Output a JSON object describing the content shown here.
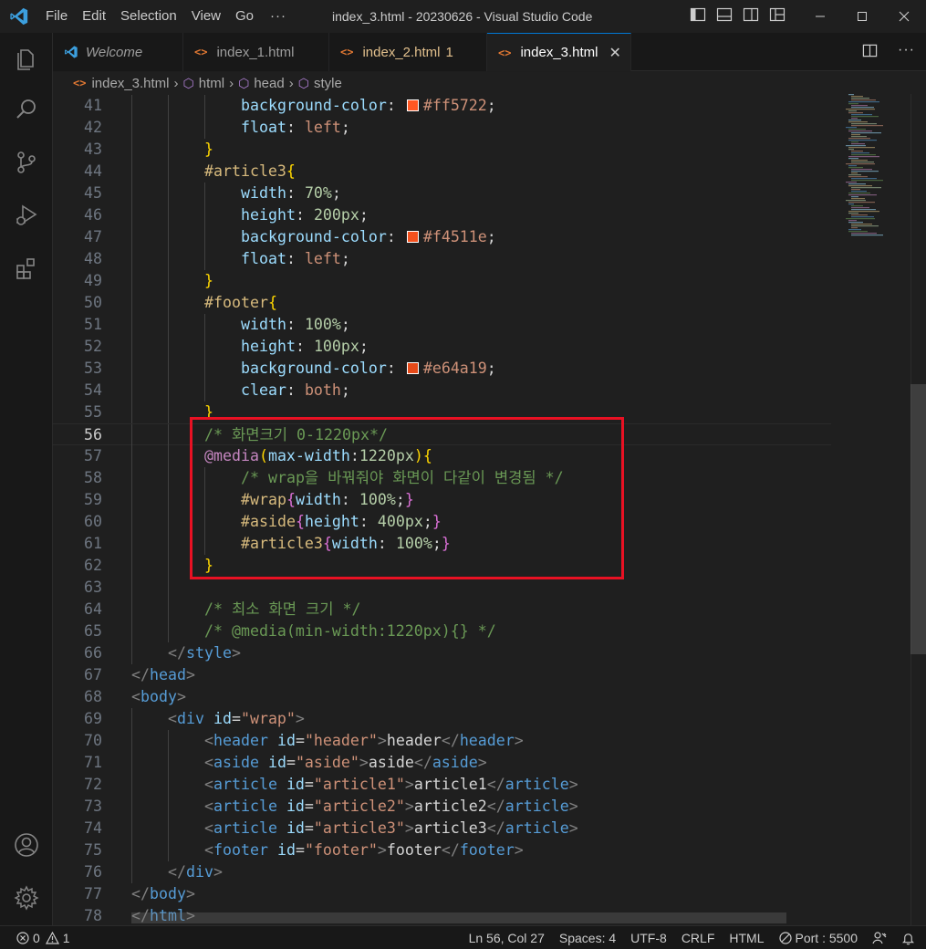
{
  "window": {
    "title": "index_3.html - 20230626 - Visual Studio Code",
    "menu": [
      "File",
      "Edit",
      "Selection",
      "View",
      "Go"
    ],
    "menu_more": "···"
  },
  "tabs": [
    {
      "label": "Welcome",
      "icon": "vscode-logo-icon",
      "state": "preview"
    },
    {
      "label": "index_1.html",
      "icon": "<>",
      "state": "normal"
    },
    {
      "label": "index_2.html",
      "icon": "<>",
      "state": "modified",
      "badge": "1"
    },
    {
      "label": "index_3.html",
      "icon": "<>",
      "state": "active"
    }
  ],
  "breadcrumb": [
    "index_3.html",
    "html",
    "head",
    "style"
  ],
  "editor": {
    "current_line": 56,
    "lines": [
      {
        "n": "41",
        "indent": 3,
        "tokens": [
          [
            "t-prop",
            "background-color"
          ],
          [
            "t-txt",
            ": "
          ],
          [
            "swatch",
            "#ff5722"
          ],
          [
            "t-str",
            "#ff5722"
          ],
          [
            "t-txt",
            ";"
          ]
        ]
      },
      {
        "n": "42",
        "indent": 3,
        "tokens": [
          [
            "t-prop",
            "float"
          ],
          [
            "t-txt",
            ": "
          ],
          [
            "t-str",
            "left"
          ],
          [
            "t-txt",
            ";"
          ]
        ]
      },
      {
        "n": "43",
        "indent": 2,
        "tokens": [
          [
            "t-b1",
            "}"
          ]
        ]
      },
      {
        "n": "44",
        "indent": 2,
        "tokens": [
          [
            "t-sel",
            "#article3"
          ],
          [
            "t-b1",
            "{"
          ]
        ]
      },
      {
        "n": "45",
        "indent": 3,
        "tokens": [
          [
            "t-prop",
            "width"
          ],
          [
            "t-txt",
            ": "
          ],
          [
            "t-num",
            "70%"
          ],
          [
            "t-txt",
            ";"
          ]
        ]
      },
      {
        "n": "46",
        "indent": 3,
        "tokens": [
          [
            "t-prop",
            "height"
          ],
          [
            "t-txt",
            ": "
          ],
          [
            "t-num",
            "200px"
          ],
          [
            "t-txt",
            ";"
          ]
        ]
      },
      {
        "n": "47",
        "indent": 3,
        "tokens": [
          [
            "t-prop",
            "background-color"
          ],
          [
            "t-txt",
            ": "
          ],
          [
            "swatch",
            "#f4511e"
          ],
          [
            "t-str",
            "#f4511e"
          ],
          [
            "t-txt",
            ";"
          ]
        ]
      },
      {
        "n": "48",
        "indent": 3,
        "tokens": [
          [
            "t-prop",
            "float"
          ],
          [
            "t-txt",
            ": "
          ],
          [
            "t-str",
            "left"
          ],
          [
            "t-txt",
            ";"
          ]
        ]
      },
      {
        "n": "49",
        "indent": 2,
        "tokens": [
          [
            "t-b1",
            "}"
          ]
        ]
      },
      {
        "n": "50",
        "indent": 2,
        "tokens": [
          [
            "t-sel",
            "#footer"
          ],
          [
            "t-b1",
            "{"
          ]
        ]
      },
      {
        "n": "51",
        "indent": 3,
        "tokens": [
          [
            "t-prop",
            "width"
          ],
          [
            "t-txt",
            ": "
          ],
          [
            "t-num",
            "100%"
          ],
          [
            "t-txt",
            ";"
          ]
        ]
      },
      {
        "n": "52",
        "indent": 3,
        "tokens": [
          [
            "t-prop",
            "height"
          ],
          [
            "t-txt",
            ": "
          ],
          [
            "t-num",
            "100px"
          ],
          [
            "t-txt",
            ";"
          ]
        ]
      },
      {
        "n": "53",
        "indent": 3,
        "tokens": [
          [
            "t-prop",
            "background-color"
          ],
          [
            "t-txt",
            ": "
          ],
          [
            "swatch",
            "#e64a19"
          ],
          [
            "t-str",
            "#e64a19"
          ],
          [
            "t-txt",
            ";"
          ]
        ]
      },
      {
        "n": "54",
        "indent": 3,
        "tokens": [
          [
            "t-prop",
            "clear"
          ],
          [
            "t-txt",
            ": "
          ],
          [
            "t-str",
            "both"
          ],
          [
            "t-txt",
            ";"
          ]
        ]
      },
      {
        "n": "55",
        "indent": 2,
        "tokens": [
          [
            "t-b1",
            "}"
          ]
        ]
      },
      {
        "n": "56",
        "indent": 2,
        "tokens": [
          [
            "t-com",
            "/* 화면크기 0-1220px*/"
          ]
        ]
      },
      {
        "n": "57",
        "indent": 2,
        "tokens": [
          [
            "t-at",
            "@media"
          ],
          [
            "t-b1",
            "("
          ],
          [
            "t-prop",
            "max-width"
          ],
          [
            "t-txt",
            ":"
          ],
          [
            "t-num",
            "1220px"
          ],
          [
            "t-b1",
            ")"
          ],
          [
            "t-b1",
            "{"
          ]
        ]
      },
      {
        "n": "58",
        "indent": 3,
        "tokens": [
          [
            "t-com",
            "/* wrap을 바꿔줘야 화면이 다같이 변경됨 */"
          ]
        ]
      },
      {
        "n": "59",
        "indent": 3,
        "tokens": [
          [
            "t-sel",
            "#wrap"
          ],
          [
            "t-b2",
            "{"
          ],
          [
            "t-prop",
            "width"
          ],
          [
            "t-txt",
            ": "
          ],
          [
            "t-num",
            "100%"
          ],
          [
            "t-txt",
            ";"
          ],
          [
            "t-b2",
            "}"
          ]
        ]
      },
      {
        "n": "60",
        "indent": 3,
        "tokens": [
          [
            "t-sel",
            "#aside"
          ],
          [
            "t-b2",
            "{"
          ],
          [
            "t-prop",
            "height"
          ],
          [
            "t-txt",
            ": "
          ],
          [
            "t-num",
            "400px"
          ],
          [
            "t-txt",
            ";"
          ],
          [
            "t-b2",
            "}"
          ]
        ]
      },
      {
        "n": "61",
        "indent": 3,
        "tokens": [
          [
            "t-sel",
            "#article3"
          ],
          [
            "t-b2",
            "{"
          ],
          [
            "t-prop",
            "width"
          ],
          [
            "t-txt",
            ": "
          ],
          [
            "t-num",
            "100%"
          ],
          [
            "t-txt",
            ";"
          ],
          [
            "t-b2",
            "}"
          ]
        ]
      },
      {
        "n": "62",
        "indent": 2,
        "tokens": [
          [
            "t-b1",
            "}"
          ]
        ]
      },
      {
        "n": "63",
        "indent": 2,
        "tokens": []
      },
      {
        "n": "64",
        "indent": 2,
        "tokens": [
          [
            "t-com",
            "/* 최소 화면 크기 */"
          ]
        ]
      },
      {
        "n": "65",
        "indent": 2,
        "tokens": [
          [
            "t-com",
            "/* @media(min-width:1220px){} */"
          ]
        ]
      },
      {
        "n": "66",
        "indent": 1,
        "tokens": [
          [
            "t-br",
            "</"
          ],
          [
            "t-tag",
            "style"
          ],
          [
            "t-br",
            ">"
          ]
        ]
      },
      {
        "n": "67",
        "indent": 0,
        "tokens": [
          [
            "t-br",
            "</"
          ],
          [
            "t-tag",
            "head"
          ],
          [
            "t-br",
            ">"
          ]
        ]
      },
      {
        "n": "68",
        "indent": 0,
        "tokens": [
          [
            "t-br",
            "<"
          ],
          [
            "t-tag",
            "body"
          ],
          [
            "t-br",
            ">"
          ]
        ]
      },
      {
        "n": "69",
        "indent": 1,
        "tokens": [
          [
            "t-br",
            "<"
          ],
          [
            "t-tag",
            "div"
          ],
          [
            "t-txt",
            " "
          ],
          [
            "t-prop",
            "id"
          ],
          [
            "t-txt",
            "="
          ],
          [
            "t-str",
            "\"wrap\""
          ],
          [
            "t-br",
            ">"
          ]
        ]
      },
      {
        "n": "70",
        "indent": 2,
        "tokens": [
          [
            "t-br",
            "<"
          ],
          [
            "t-tag",
            "header"
          ],
          [
            "t-txt",
            " "
          ],
          [
            "t-prop",
            "id"
          ],
          [
            "t-txt",
            "="
          ],
          [
            "t-str",
            "\"header\""
          ],
          [
            "t-br",
            ">"
          ],
          [
            "t-txt",
            "header"
          ],
          [
            "t-br",
            "</"
          ],
          [
            "t-tag",
            "header"
          ],
          [
            "t-br",
            ">"
          ]
        ]
      },
      {
        "n": "71",
        "indent": 2,
        "tokens": [
          [
            "t-br",
            "<"
          ],
          [
            "t-tag",
            "aside"
          ],
          [
            "t-txt",
            " "
          ],
          [
            "t-prop",
            "id"
          ],
          [
            "t-txt",
            "="
          ],
          [
            "t-str",
            "\"aside\""
          ],
          [
            "t-br",
            ">"
          ],
          [
            "t-txt",
            "aside"
          ],
          [
            "t-br",
            "</"
          ],
          [
            "t-tag",
            "aside"
          ],
          [
            "t-br",
            ">"
          ]
        ]
      },
      {
        "n": "72",
        "indent": 2,
        "tokens": [
          [
            "t-br",
            "<"
          ],
          [
            "t-tag",
            "article"
          ],
          [
            "t-txt",
            " "
          ],
          [
            "t-prop",
            "id"
          ],
          [
            "t-txt",
            "="
          ],
          [
            "t-str",
            "\"article1\""
          ],
          [
            "t-br",
            ">"
          ],
          [
            "t-txt",
            "article1"
          ],
          [
            "t-br",
            "</"
          ],
          [
            "t-tag",
            "article"
          ],
          [
            "t-br",
            ">"
          ]
        ]
      },
      {
        "n": "73",
        "indent": 2,
        "tokens": [
          [
            "t-br",
            "<"
          ],
          [
            "t-tag",
            "article"
          ],
          [
            "t-txt",
            " "
          ],
          [
            "t-prop",
            "id"
          ],
          [
            "t-txt",
            "="
          ],
          [
            "t-str",
            "\"article2\""
          ],
          [
            "t-br",
            ">"
          ],
          [
            "t-txt",
            "article2"
          ],
          [
            "t-br",
            "</"
          ],
          [
            "t-tag",
            "article"
          ],
          [
            "t-br",
            ">"
          ]
        ]
      },
      {
        "n": "74",
        "indent": 2,
        "tokens": [
          [
            "t-br",
            "<"
          ],
          [
            "t-tag",
            "article"
          ],
          [
            "t-txt",
            " "
          ],
          [
            "t-prop",
            "id"
          ],
          [
            "t-txt",
            "="
          ],
          [
            "t-str",
            "\"article3\""
          ],
          [
            "t-br",
            ">"
          ],
          [
            "t-txt",
            "article3"
          ],
          [
            "t-br",
            "</"
          ],
          [
            "t-tag",
            "article"
          ],
          [
            "t-br",
            ">"
          ]
        ]
      },
      {
        "n": "75",
        "indent": 2,
        "tokens": [
          [
            "t-br",
            "<"
          ],
          [
            "t-tag",
            "footer"
          ],
          [
            "t-txt",
            " "
          ],
          [
            "t-prop",
            "id"
          ],
          [
            "t-txt",
            "="
          ],
          [
            "t-str",
            "\"footer\""
          ],
          [
            "t-br",
            ">"
          ],
          [
            "t-txt",
            "footer"
          ],
          [
            "t-br",
            "</"
          ],
          [
            "t-tag",
            "footer"
          ],
          [
            "t-br",
            ">"
          ]
        ]
      },
      {
        "n": "76",
        "indent": 1,
        "tokens": [
          [
            "t-br",
            "</"
          ],
          [
            "t-tag",
            "div"
          ],
          [
            "t-br",
            ">"
          ]
        ]
      },
      {
        "n": "77",
        "indent": 0,
        "tokens": [
          [
            "t-br",
            "</"
          ],
          [
            "t-tag",
            "body"
          ],
          [
            "t-br",
            ">"
          ]
        ]
      },
      {
        "n": "78",
        "indent": 0,
        "tokens": [
          [
            "t-br",
            "</"
          ],
          [
            "t-tag",
            "html"
          ],
          [
            "t-br",
            ">"
          ]
        ]
      }
    ]
  },
  "statusbar": {
    "errors": "0",
    "warnings": "1",
    "position": "Ln 56, Col 27",
    "spaces": "Spaces: 4",
    "encoding": "UTF-8",
    "eol": "CRLF",
    "language": "HTML",
    "port": "Port : 5500"
  },
  "colors": {
    "accent": "#0078d4",
    "highlight_box": "#e81123",
    "vscode_blue": "#3c9fde"
  }
}
